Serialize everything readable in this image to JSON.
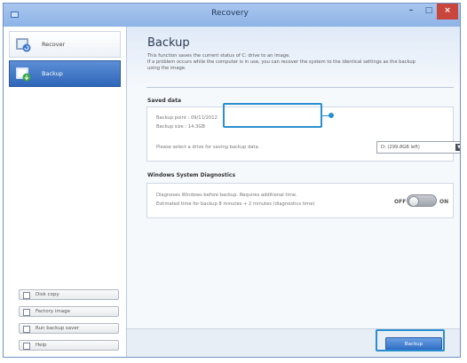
{
  "window": {
    "title": "Recovery"
  },
  "titlebar": {
    "minimize": "–",
    "maximize": "□",
    "close": "×"
  },
  "sidebar": {
    "items": [
      {
        "label": "Recover",
        "icon": "recover-icon",
        "selected": false
      },
      {
        "label": "Backup",
        "icon": "backup-icon",
        "selected": true
      }
    ],
    "tools": [
      {
        "label": "Disk copy",
        "icon": "disk-copy-icon"
      },
      {
        "label": "Factory image",
        "icon": "factory-image-icon"
      },
      {
        "label": "Run backup saver",
        "icon": "run-backup-icon"
      },
      {
        "label": "Help",
        "icon": "help-icon"
      }
    ]
  },
  "main": {
    "title": "Backup",
    "description": [
      "This function saves the current status of C: drive to an image.",
      "If a problem occurs while the computer is in use, you can recover the system to the identical settings as the backup",
      "using the image."
    ],
    "saved_data": {
      "title": "Saved data",
      "backup_point": "Backup point : 09/11/2012",
      "backup_size": "Backup size : 14.3GB",
      "select_prompt": "Please select a drive for saving backup data.",
      "drive_value": "D: (299.8GB left)"
    },
    "diagnostics": {
      "title": "Windows System Diagnostics",
      "line1": "Diagnoses Windows before backup. Requires additional time.",
      "line2": "Estimated time for backup 8 minutes + 2 minutes (diagnostics time)",
      "toggle_off": "OFF",
      "toggle_on": "ON",
      "toggle_state": "off"
    },
    "backup_button": "Backup"
  },
  "colors": {
    "accent": "#2f6cc4",
    "highlight": "#2a8fcf",
    "close": "#c9463d"
  }
}
